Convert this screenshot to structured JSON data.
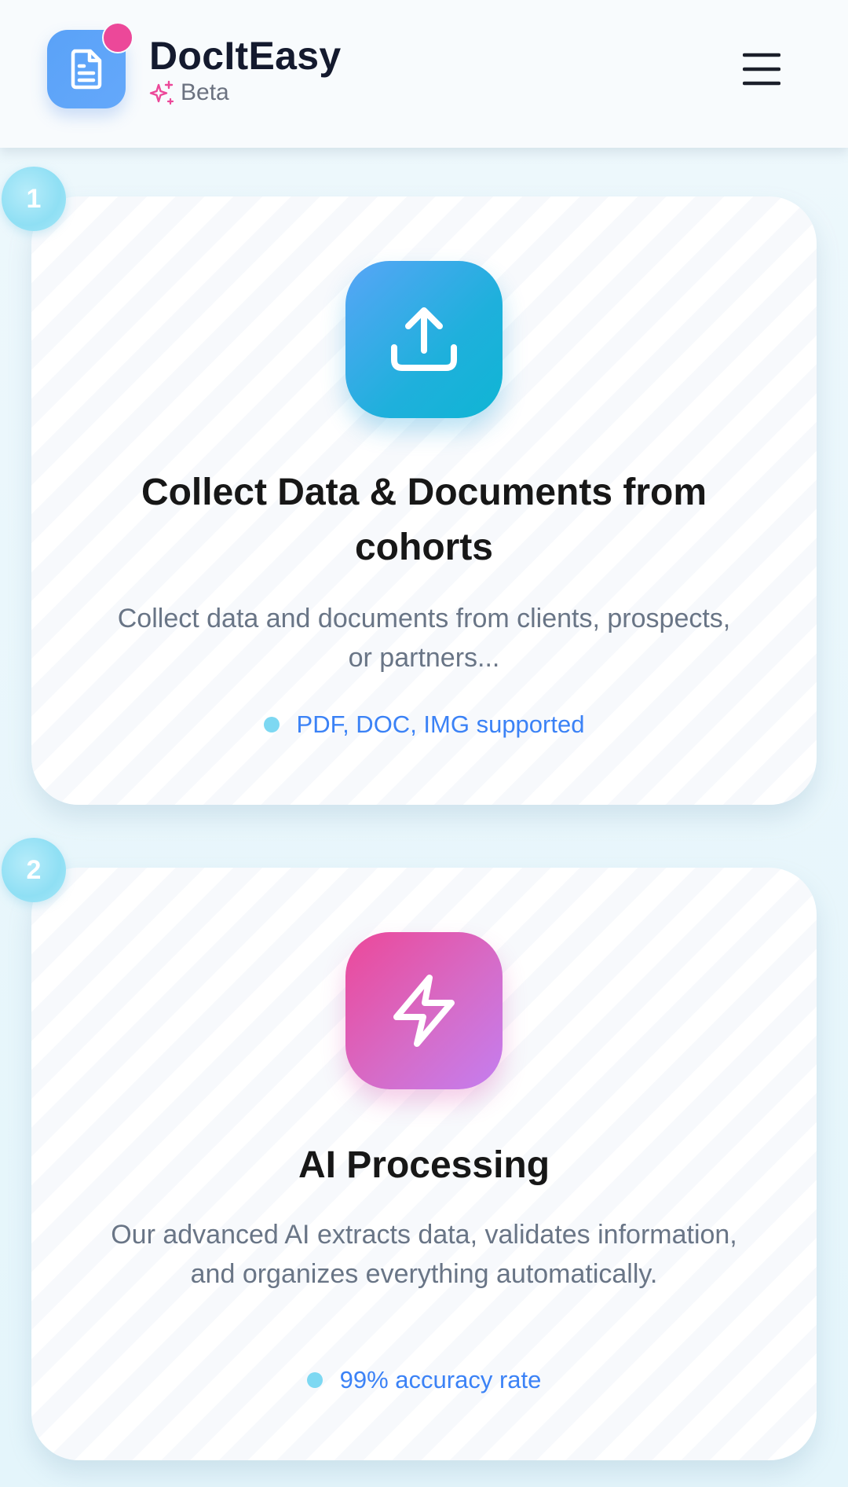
{
  "header": {
    "brand_name": "DocItEasy",
    "beta_label": "Beta",
    "logo_icon": "document-icon",
    "badge_icon": "sparkle-icon",
    "menu_icon": "hamburger-menu-icon"
  },
  "steps": [
    {
      "number": "1",
      "icon": "upload-icon",
      "title": "Collect Data & Documents from cohorts",
      "description": "Collect data and documents from clients, prospects, or partners...",
      "feature": "PDF, DOC, IMG supported"
    },
    {
      "number": "2",
      "icon": "lightning-icon",
      "title": "AI Processing",
      "description": "Our advanced AI extracts data, validates information, and organizes everything automatically.",
      "feature": "99% accuracy rate"
    }
  ],
  "colors": {
    "accent_blue": "#3b82f6",
    "brand_pink": "#ec4899",
    "badge_cyan": "#8fdff4",
    "title_text": "#171717",
    "body_text": "#697586"
  }
}
